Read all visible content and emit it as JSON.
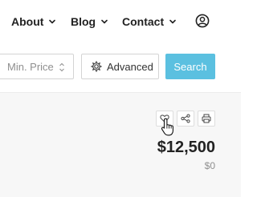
{
  "nav": {
    "items": [
      {
        "label": "About"
      },
      {
        "label": "Blog"
      },
      {
        "label": "Contact"
      }
    ]
  },
  "search": {
    "min_price_placeholder": "Min. Price",
    "advanced_label": "Advanced",
    "search_label": "Search",
    "accent_color": "#5bc0e0"
  },
  "listing": {
    "price": "$12,500",
    "secondary_price": "$0"
  },
  "icons": {
    "user": "user-circle-icon",
    "favorite": "heart-icon",
    "share": "share-icon",
    "print": "printer-icon",
    "advanced": "gear-icon"
  }
}
